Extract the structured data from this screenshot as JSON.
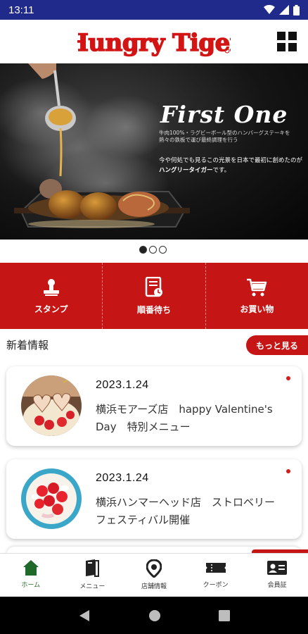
{
  "status_bar": {
    "time": "13:11"
  },
  "header": {
    "logo_text": "Hungry Tiger"
  },
  "banner": {
    "title": "First One",
    "subtitle": "牛肉100%・ラグビーボール型のハンバーグステーキを熱々の鉄板で運び最終調理を行う",
    "text_part1": "今や何処でも見るこの光景を日本で最初に創めたのが",
    "text_highlight": "ハングリータイガー",
    "text_part2": "です。"
  },
  "carousel": {
    "total": 3,
    "active": 0
  },
  "actions": [
    {
      "label": "スタンプ",
      "icon": "stamp-icon"
    },
    {
      "label": "順番待ち",
      "icon": "queue-ticket-icon"
    },
    {
      "label": "お買い物",
      "icon": "cart-icon"
    }
  ],
  "news": {
    "title": "新着情報",
    "more_label": "もっと見る",
    "items": [
      {
        "date": "2023.1.24",
        "text": "横浜モアーズ店　happy Valentine's Day　特別メニュー"
      },
      {
        "date": "2023.1.24",
        "text": "横浜ハンマーヘッド店　ストロベリーフェスティバル開催"
      }
    ]
  },
  "bottom_nav": [
    {
      "label": "ホーム",
      "icon": "home-icon"
    },
    {
      "label": "メニュー",
      "icon": "menu-book-icon"
    },
    {
      "label": "店舗情報",
      "icon": "location-pin-icon"
    },
    {
      "label": "クーポン",
      "icon": "coupon-ticket-icon"
    },
    {
      "label": "会員証",
      "icon": "member-card-icon"
    }
  ],
  "colors": {
    "brand_red": "#c51515",
    "status_bar": "#1f2a8a",
    "active_nav": "#2a6a2a"
  }
}
